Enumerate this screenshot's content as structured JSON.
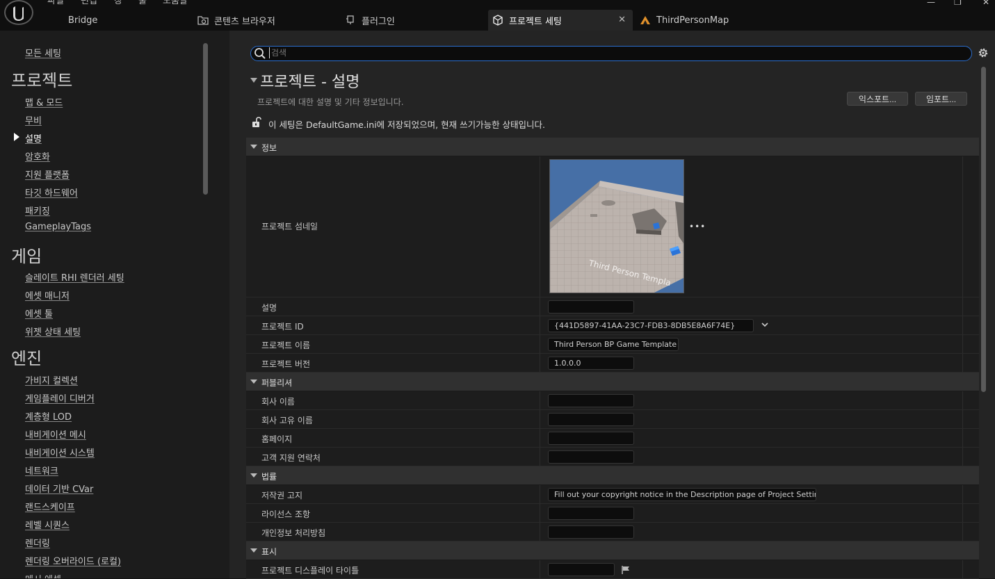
{
  "menu": [
    "파일",
    "편집",
    "창",
    "툴",
    "도움말"
  ],
  "tabs": [
    {
      "label": "Bridge",
      "icon": "bridge-icon"
    },
    {
      "label": "콘텐츠 브라우저",
      "icon": "content-browser-icon"
    },
    {
      "label": "플러그인",
      "icon": "plugin-icon"
    },
    {
      "label": "프로젝트 세팅",
      "icon": "project-settings-icon",
      "active": true
    },
    {
      "label": "ThirdPersonMap",
      "icon": "level-icon"
    }
  ],
  "sidebar": {
    "all_settings": "모든 세팅",
    "categories": [
      {
        "title": "프로젝트",
        "items": [
          "맵 & 모드",
          "무비",
          "설명",
          "암호화",
          "지원 플랫폼",
          "타깃 하드웨어",
          "패키징",
          "GameplayTags"
        ]
      },
      {
        "title": "게임",
        "items": [
          "슬레이트 RHI 렌더러 세팅",
          "에셋 매니저",
          "에셋 툴",
          "위젯 상태 세팅"
        ]
      },
      {
        "title": "엔진",
        "items": [
          "가비지 컬렉션",
          "게임플레이 디버거",
          "계층형 LOD",
          "내비게이션 메시",
          "내비게이션 시스템",
          "네트워크",
          "데이터 기반 CVar",
          "랜드스케이프",
          "레벨 시퀀스",
          "렌더링",
          "렌더링 오버라이드 (로컬)",
          "메시 에셋"
        ]
      }
    ],
    "selected": "설명"
  },
  "search": {
    "placeholder": "검색"
  },
  "page": {
    "title": "프로젝트 - 설명",
    "subtitle": "프로젝트에 대한 설명 및 기타 정보입니다.",
    "export_label": "익스포트...",
    "import_label": "임포트...",
    "save_notice": "이 세팅은 DefaultGame.ini에 저장되었으며, 현재 쓰기가능한 상태입니다."
  },
  "sections": {
    "info": {
      "title": "정보",
      "thumbnail_label": "프로젝트 섬네일",
      "thumbnail_caption": "Third Person Templa",
      "rows": [
        {
          "label": "설명",
          "value": ""
        },
        {
          "label": "프로젝트 ID",
          "value": "{441D5897-41AA-23C7-FDB3-8DB5E8A6F74E}"
        },
        {
          "label": "프로젝트 이름",
          "value": "Third Person BP Game Template"
        },
        {
          "label": "프로젝트 버전",
          "value": "1.0.0.0"
        }
      ]
    },
    "publisher": {
      "title": "퍼블리셔",
      "rows": [
        {
          "label": "회사 이름",
          "value": ""
        },
        {
          "label": "회사 고유 이름",
          "value": ""
        },
        {
          "label": "홈페이지",
          "value": ""
        },
        {
          "label": "고객 지원 연락처",
          "value": ""
        }
      ]
    },
    "legal": {
      "title": "법률",
      "rows": [
        {
          "label": "저작권 고지",
          "value": "Fill out your copyright notice in the Description page of Project Settings."
        },
        {
          "label": "라이선스 조항",
          "value": ""
        },
        {
          "label": "개인정보 처리방침",
          "value": ""
        }
      ]
    },
    "display": {
      "title": "표시",
      "rows": [
        {
          "label": "프로젝트 디스플레이 타이틀",
          "value": ""
        }
      ]
    }
  },
  "colors": {
    "accent": "#2c6fcf",
    "bg": "#242424",
    "sidebar": "#1c1c1c"
  }
}
